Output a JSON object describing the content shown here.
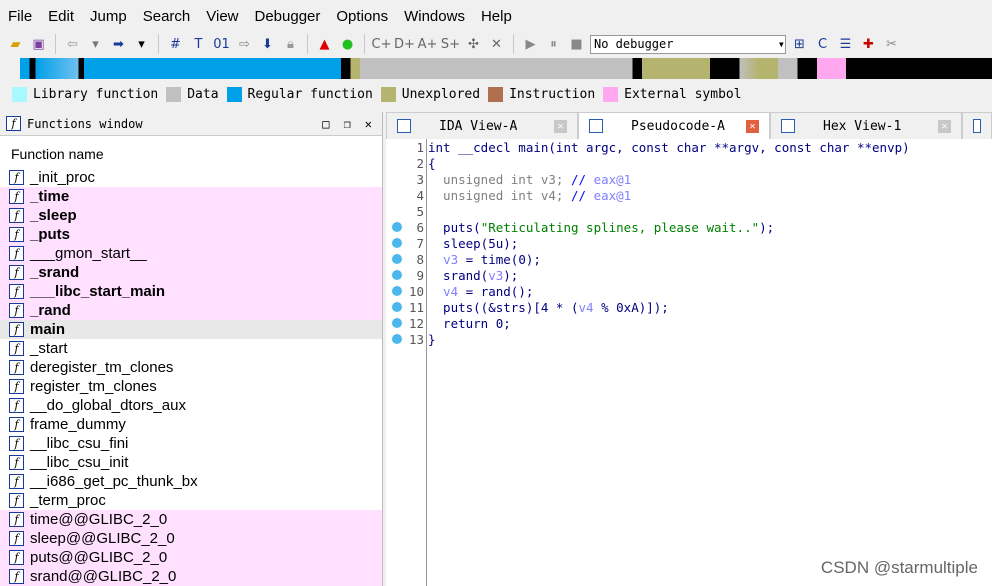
{
  "menu": [
    "File",
    "Edit",
    "Jump",
    "Search",
    "View",
    "Debugger",
    "Options",
    "Windows",
    "Help"
  ],
  "toolbar": {
    "debugger_select": "No debugger"
  },
  "legend": [
    {
      "label": "Library function",
      "color": "#a8f8ff"
    },
    {
      "label": "Data",
      "color": "#c0c0c0"
    },
    {
      "label": "Regular function",
      "color": "#00a0e8"
    },
    {
      "label": "Unexplored",
      "color": "#b4b46e"
    },
    {
      "label": "Instruction",
      "color": "#b07050"
    },
    {
      "label": "External symbol",
      "color": "#ffa8f0"
    }
  ],
  "functions_window": {
    "title": "Functions window",
    "column": "Function name",
    "items": [
      {
        "name": "_init_proc",
        "style": ""
      },
      {
        "name": "_time",
        "style": "pink bold"
      },
      {
        "name": "_sleep",
        "style": "pink bold"
      },
      {
        "name": "_puts",
        "style": "pink bold"
      },
      {
        "name": "___gmon_start__",
        "style": "pink"
      },
      {
        "name": "_srand",
        "style": "pink bold"
      },
      {
        "name": "___libc_start_main",
        "style": "pink bold"
      },
      {
        "name": "_rand",
        "style": "pink bold"
      },
      {
        "name": "main",
        "style": "sel bold"
      },
      {
        "name": "_start",
        "style": ""
      },
      {
        "name": "deregister_tm_clones",
        "style": ""
      },
      {
        "name": "register_tm_clones",
        "style": ""
      },
      {
        "name": "__do_global_dtors_aux",
        "style": ""
      },
      {
        "name": "frame_dummy",
        "style": ""
      },
      {
        "name": "__libc_csu_fini",
        "style": ""
      },
      {
        "name": "__libc_csu_init",
        "style": ""
      },
      {
        "name": "__i686_get_pc_thunk_bx",
        "style": ""
      },
      {
        "name": "_term_proc",
        "style": ""
      },
      {
        "name": "time@@GLIBC_2_0",
        "style": "pink"
      },
      {
        "name": "sleep@@GLIBC_2_0",
        "style": "pink"
      },
      {
        "name": "puts@@GLIBC_2_0",
        "style": "pink"
      },
      {
        "name": "srand@@GLIBC_2_0",
        "style": "pink"
      }
    ]
  },
  "tabs": [
    {
      "label": "IDA View-A",
      "active": false
    },
    {
      "label": "Pseudocode-A",
      "active": true
    },
    {
      "label": "Hex View-1",
      "active": false
    }
  ],
  "code": [
    {
      "n": "1",
      "bp": false,
      "seg": [
        [
          "int __cdecl main(int argc, const char **argv, const char **envp)",
          "kw"
        ]
      ]
    },
    {
      "n": "2",
      "bp": false,
      "seg": [
        [
          "{",
          "kw"
        ]
      ]
    },
    {
      "n": "3",
      "bp": false,
      "seg": [
        [
          "  unsigned int v3; ",
          "gr"
        ],
        [
          "// ",
          "cm"
        ],
        [
          "eax@1",
          "vr"
        ]
      ]
    },
    {
      "n": "4",
      "bp": false,
      "seg": [
        [
          "  unsigned int v4; ",
          "gr"
        ],
        [
          "// ",
          "cm"
        ],
        [
          "eax@1",
          "vr"
        ]
      ]
    },
    {
      "n": "5",
      "bp": false,
      "seg": []
    },
    {
      "n": "6",
      "bp": true,
      "seg": [
        [
          "  puts(",
          "kw"
        ],
        [
          "\"Reticulating splines, please wait..\"",
          "st"
        ],
        [
          ");",
          "kw"
        ]
      ]
    },
    {
      "n": "7",
      "bp": true,
      "seg": [
        [
          "  sleep(5u);",
          "kw"
        ]
      ]
    },
    {
      "n": "8",
      "bp": true,
      "seg": [
        [
          "  ",
          "kw"
        ],
        [
          "v3",
          "vr"
        ],
        [
          " = time(0);",
          "kw"
        ]
      ]
    },
    {
      "n": "9",
      "bp": true,
      "seg": [
        [
          "  srand(",
          "kw"
        ],
        [
          "v3",
          "vr"
        ],
        [
          ");",
          "kw"
        ]
      ]
    },
    {
      "n": "10",
      "bp": true,
      "seg": [
        [
          "  ",
          "kw"
        ],
        [
          "v4",
          "vr"
        ],
        [
          " = rand();",
          "kw"
        ]
      ]
    },
    {
      "n": "11",
      "bp": true,
      "seg": [
        [
          "  puts((&strs)[4 * (",
          "kw"
        ],
        [
          "v4",
          "vr"
        ],
        [
          " % 0xA)]);",
          "kw"
        ]
      ]
    },
    {
      "n": "12",
      "bp": true,
      "seg": [
        [
          "  return 0;",
          "kw"
        ]
      ]
    },
    {
      "n": "13",
      "bp": true,
      "seg": [
        [
          "}",
          "kw"
        ]
      ]
    }
  ],
  "watermark": "CSDN @starmultiple"
}
